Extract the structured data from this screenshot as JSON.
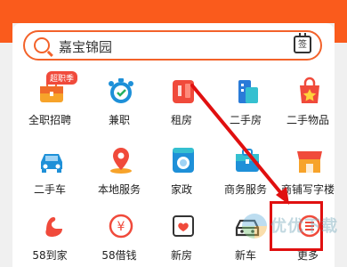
{
  "search": {
    "text": "嘉宝锦园",
    "sign_label": "签"
  },
  "grid": [
    {
      "label": "全职招聘",
      "badge": "超职季",
      "icon": "briefcase-icon"
    },
    {
      "label": "兼职",
      "icon": "stopwatch-icon"
    },
    {
      "label": "租房",
      "icon": "rent-card-icon"
    },
    {
      "label": "二手房",
      "icon": "building-icon"
    },
    {
      "label": "二手物品",
      "icon": "shopping-bag-icon"
    },
    {
      "label": "二手车",
      "icon": "car-icon"
    },
    {
      "label": "本地服务",
      "icon": "location-pin-icon"
    },
    {
      "label": "家政",
      "icon": "washing-machine-icon"
    },
    {
      "label": "商务服务",
      "icon": "briefcase-blue-icon"
    },
    {
      "label": "商铺写字楼",
      "icon": "storefront-icon"
    },
    {
      "label": "58到家",
      "icon": "swan-icon"
    },
    {
      "label": "58借钱",
      "icon": "yuan-coin-icon"
    },
    {
      "label": "新房",
      "icon": "heart-house-icon"
    },
    {
      "label": "新车",
      "icon": "car-outline-icon"
    },
    {
      "label": "更多",
      "icon": "more-icon"
    }
  ],
  "watermark": "优优下载",
  "colors": {
    "accent": "#fa5b1c",
    "highlight": "#e01010"
  }
}
